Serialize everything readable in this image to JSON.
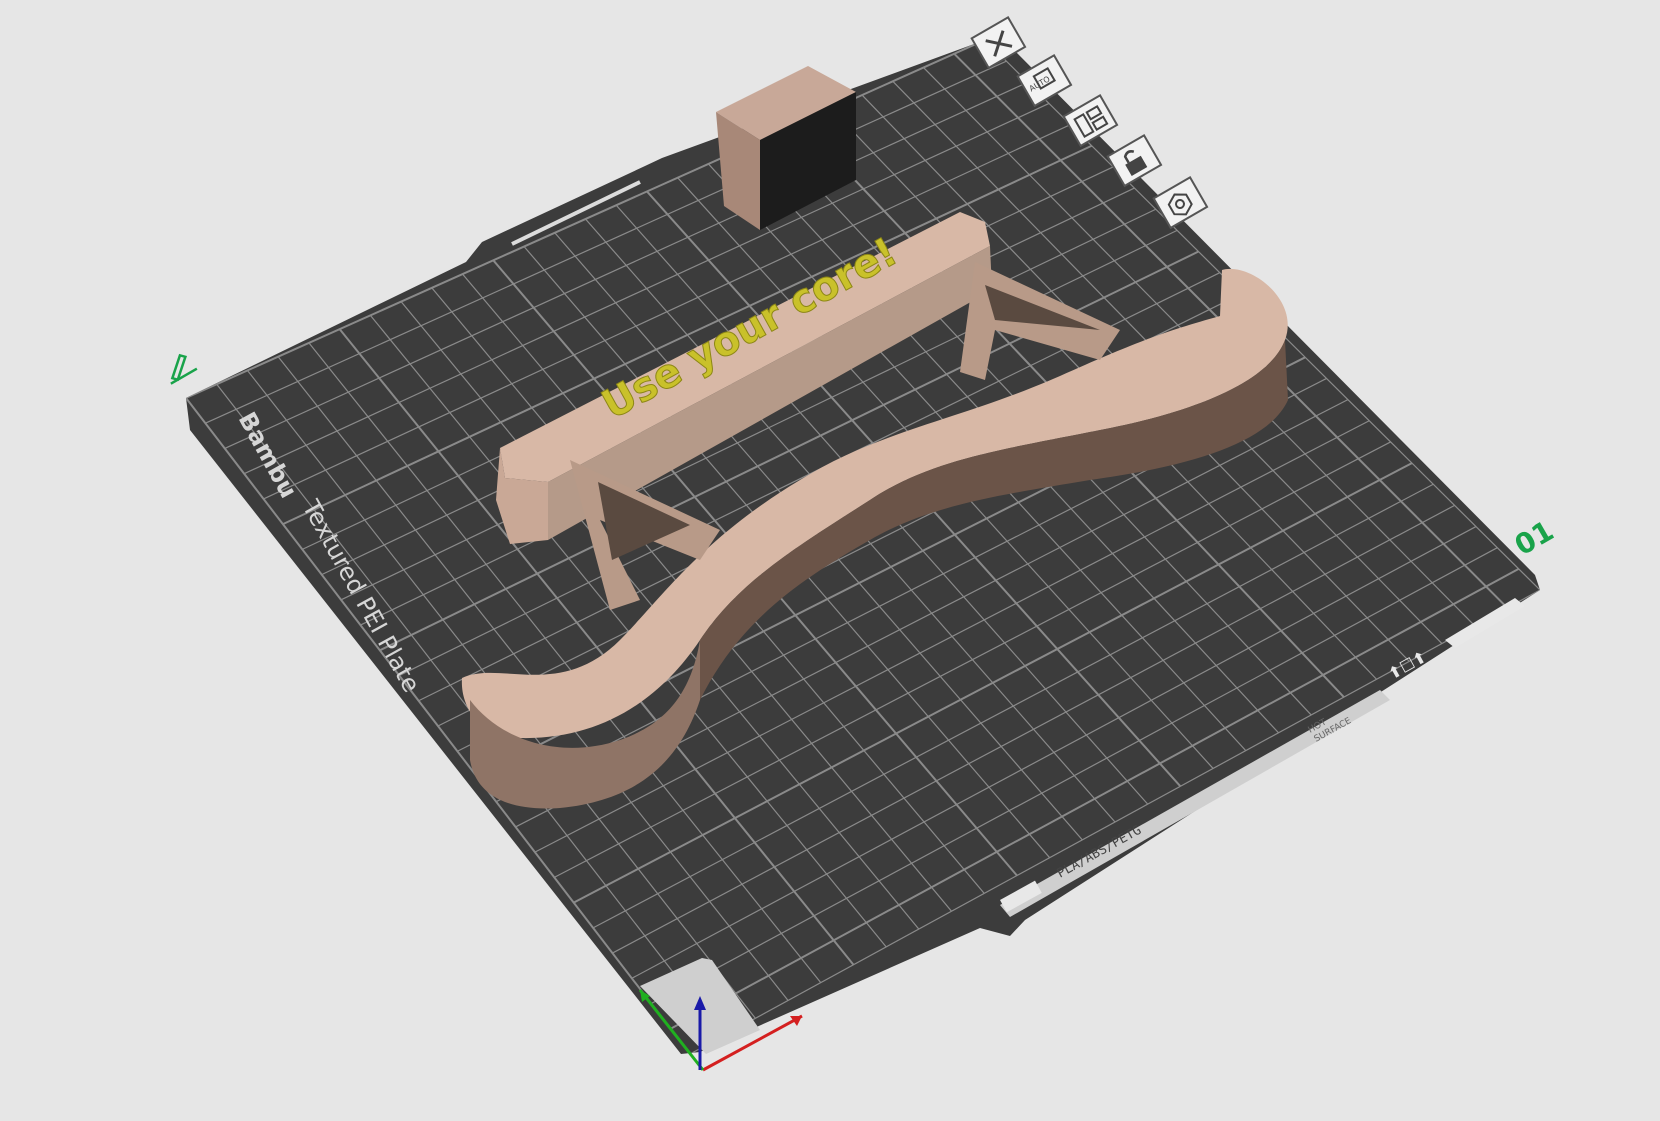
{
  "app": {
    "view": "3D plate preview"
  },
  "plate": {
    "brand": "Bambu",
    "type_label": "Textured PEI Plate",
    "plate_number": "01",
    "material_strip": "PLA/ABS/PETG",
    "warning_line1": "HOT",
    "warning_line2": "SURFACE",
    "grid_color": "#8a8a8a",
    "surface_color": "#3c3c3c"
  },
  "model": {
    "embossed_text": "Use your core!",
    "body_color": "#d8b8a6",
    "text_color": "#c9c12a",
    "small_block_color": "#1c1c1c"
  },
  "plate_toolbar": {
    "items": [
      {
        "name": "delete-plate",
        "icon": "close-icon"
      },
      {
        "name": "auto-orient",
        "icon": "auto-orient-icon"
      },
      {
        "name": "arrange",
        "icon": "arrange-icon"
      },
      {
        "name": "lock-plate",
        "icon": "lock-icon"
      },
      {
        "name": "plate-settings",
        "icon": "gear-icon"
      }
    ]
  },
  "axes": {
    "x_color": "#d42020",
    "y_color": "#20b020",
    "z_color": "#1a1aa8"
  },
  "accent_color": "#19a34a"
}
